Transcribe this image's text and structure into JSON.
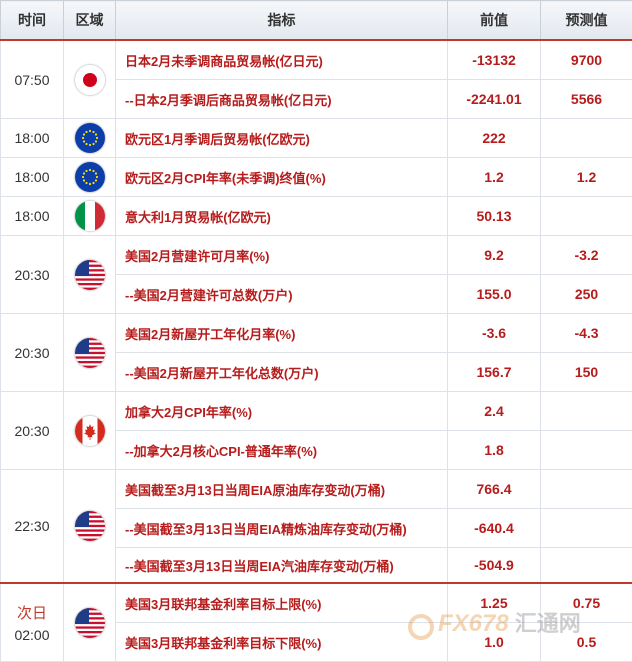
{
  "header": {
    "time": "时间",
    "region": "区域",
    "indicator": "指标",
    "previous": "前值",
    "forecast": "预测值"
  },
  "groups": {
    "g1": {
      "time": "07:50",
      "flag": "japan-flag-icon",
      "rows": [
        {
          "indicator": "日本2月未季调商品贸易帐(亿日元)",
          "previous": "-13132",
          "forecast": "9700"
        },
        {
          "indicator": "--日本2月季调后商品贸易帐(亿日元)",
          "previous": "-2241.01",
          "forecast": "5566"
        }
      ]
    },
    "g2": {
      "time": "18:00",
      "flag": "eu-flag-icon",
      "rows": [
        {
          "indicator": "欧元区1月季调后贸易帐(亿欧元)",
          "previous": "222",
          "forecast": ""
        }
      ]
    },
    "g3": {
      "time": "18:00",
      "flag": "eu-flag-icon",
      "rows": [
        {
          "indicator": "欧元区2月CPI年率(未季调)终值(%)",
          "previous": "1.2",
          "forecast": "1.2"
        }
      ]
    },
    "g4": {
      "time": "18:00",
      "flag": "italy-flag-icon",
      "rows": [
        {
          "indicator": "意大利1月贸易帐(亿欧元)",
          "previous": "50.13",
          "forecast": ""
        }
      ]
    },
    "g5": {
      "time": "20:30",
      "flag": "usa-flag-icon",
      "rows": [
        {
          "indicator": "美国2月营建许可月率(%)",
          "previous": "9.2",
          "forecast": "-3.2"
        },
        {
          "indicator": "--美国2月营建许可总数(万户)",
          "previous": "155.0",
          "forecast": "250"
        }
      ]
    },
    "g6": {
      "time": "20:30",
      "flag": "usa-flag-icon",
      "rows": [
        {
          "indicator": "美国2月新屋开工年化月率(%)",
          "previous": "-3.6",
          "forecast": "-4.3"
        },
        {
          "indicator": "--美国2月新屋开工年化总数(万户)",
          "previous": "156.7",
          "forecast": "150"
        }
      ]
    },
    "g7": {
      "time": "20:30",
      "flag": "canada-flag-icon",
      "rows": [
        {
          "indicator": "加拿大2月CPI年率(%)",
          "previous": "2.4",
          "forecast": ""
        },
        {
          "indicator": "--加拿大2月核心CPI-普通年率(%)",
          "previous": "1.8",
          "forecast": ""
        }
      ]
    },
    "g8": {
      "time": "22:30",
      "flag": "usa-flag-icon",
      "rows": [
        {
          "indicator": "美国截至3月13日当周EIA原油库存变动(万桶)",
          "previous": "766.4",
          "forecast": ""
        },
        {
          "indicator": "--美国截至3月13日当周EIA精炼油库存变动(万桶)",
          "previous": "-640.4",
          "forecast": ""
        },
        {
          "indicator": "--美国截至3月13日当周EIA汽油库存变动(万桶)",
          "previous": "-504.9",
          "forecast": ""
        }
      ]
    },
    "g9": {
      "day_label": "次日",
      "time": "02:00",
      "flag": "usa-flag-icon",
      "rows": [
        {
          "indicator": "美国3月联邦基金利率目标上限(%)",
          "previous": "1.25",
          "forecast": "0.75"
        },
        {
          "indicator": "美国3月联邦基金利率目标下限(%)",
          "previous": "1.0",
          "forecast": "0.5"
        }
      ]
    }
  },
  "watermark": {
    "brand": "FX678",
    "cn": "汇通网"
  },
  "colors": {
    "value_red": "#b71c1c",
    "header_rule": "#c0392b"
  }
}
